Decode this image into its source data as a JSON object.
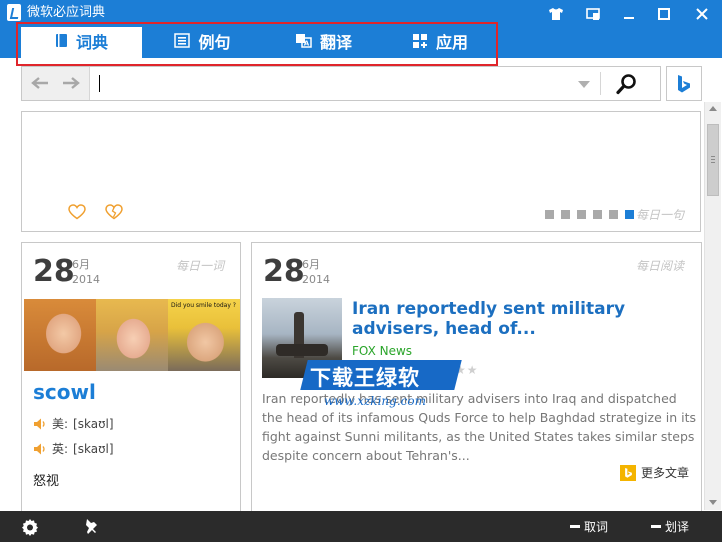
{
  "window": {
    "title": "微软必应词典"
  },
  "tabs": [
    {
      "label": "词典",
      "icon": "book-icon",
      "active": true
    },
    {
      "label": "例句",
      "icon": "list-icon",
      "active": false
    },
    {
      "label": "翻译",
      "icon": "translate-icon",
      "active": false
    },
    {
      "label": "应用",
      "icon": "apps-icon",
      "active": false
    }
  ],
  "search": {
    "value": "",
    "placeholder": ""
  },
  "banner": {
    "tag": "每日一句",
    "pages": 6,
    "active_page": 6
  },
  "word_card": {
    "day": "28",
    "month": "6月",
    "year": "2014",
    "tag": "每日一词",
    "image_caption": "Did you smile today ?",
    "word": "scowl",
    "us_label": "美:",
    "us_phonetic": "[skaʊl]",
    "uk_label": "英:",
    "uk_phonetic": "[skaʊl]",
    "meaning": "怒视"
  },
  "read_card": {
    "day": "28",
    "month": "6月",
    "year": "2014",
    "tag": "每日阅读",
    "title": "Iran reportedly sent military advisers, head of...",
    "source": "FOX News",
    "stars": "★★",
    "body": "Iran reportedly has sent military advisers into Iraq and dispatched the head of its infamous Quds Force to help Baghdad strategize in its fight against Sunni militants, as the United States takes similar steps despite concern about Tehran's...",
    "more": "更多文章"
  },
  "watermark": {
    "text": "下载王绿软",
    "url": "www.xzking.com"
  },
  "bottom": {
    "fetch_label": "取词",
    "select_label": "划译"
  },
  "colors": {
    "accent": "#1c7ed6",
    "link": "#1c6fc0",
    "source": "#2aa52a",
    "highlight_box": "#e0252b",
    "bottom_bar": "#2b2b2b"
  }
}
